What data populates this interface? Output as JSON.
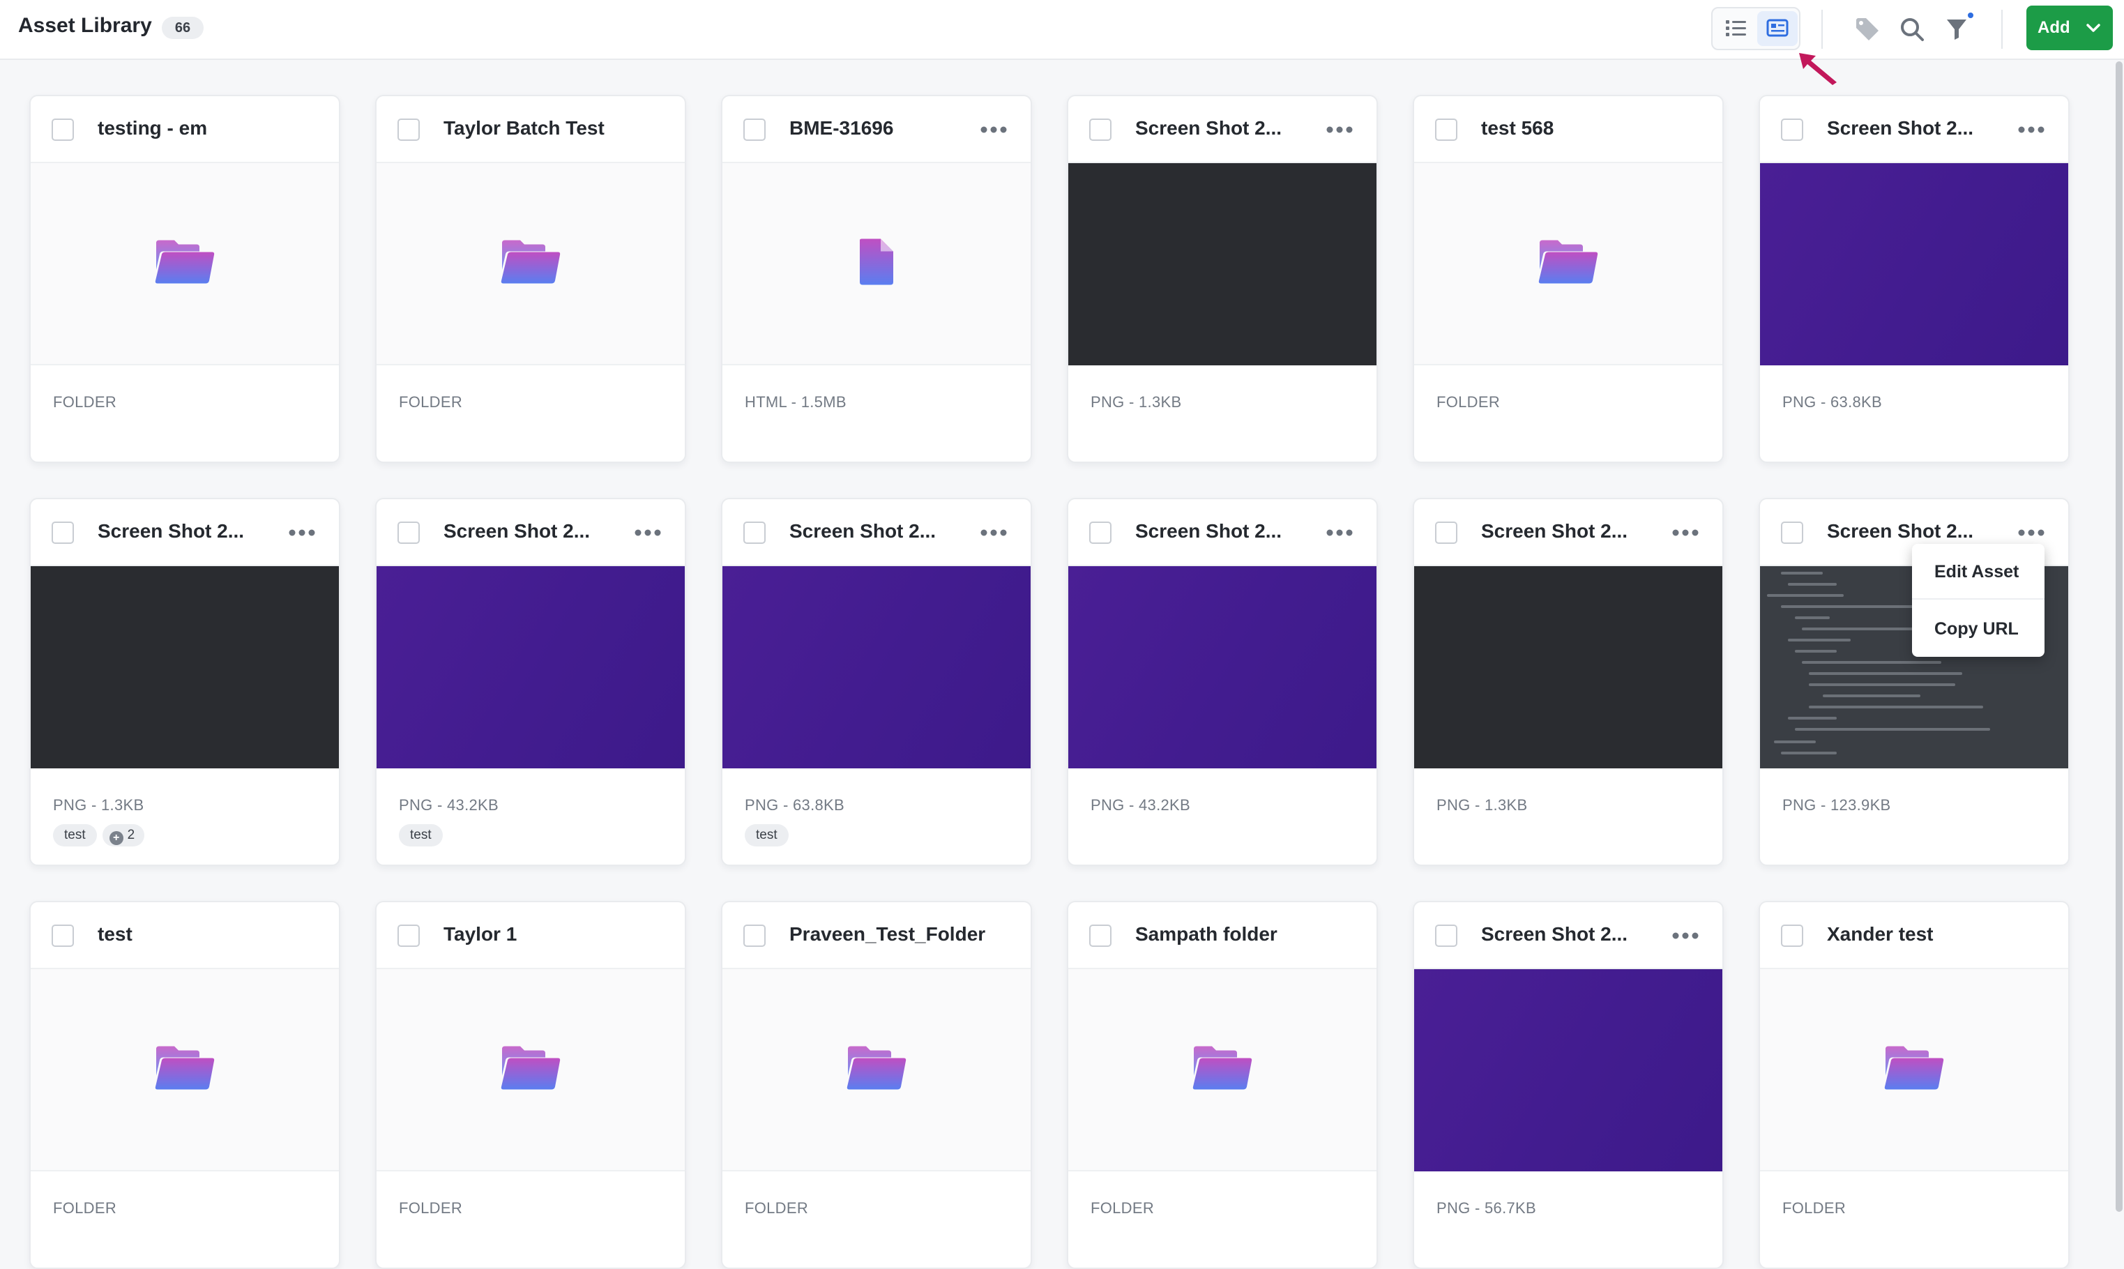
{
  "header": {
    "title": "Asset Library",
    "count": "66",
    "add_label": "Add",
    "icons": [
      "list-view-icon",
      "grid-view-icon",
      "tag-icon",
      "search-icon",
      "filter-icon",
      "chevron-down-icon"
    ]
  },
  "colors": {
    "accent_green": "#1c9c47",
    "active_view": "#2e6de0",
    "thumb_purple": "#421c8f",
    "thumb_dark": "#2a2c30",
    "folder_gradient_top": "#c04fc2",
    "folder_gradient_bottom": "#5a7ef0",
    "cursor_pink": "#c2185b"
  },
  "assets": [
    {
      "title": "testing - em",
      "meta": "FOLDER",
      "thumb": "folder",
      "menu": false,
      "tags": []
    },
    {
      "title": "Taylor Batch Test",
      "meta": "FOLDER",
      "thumb": "folder",
      "menu": false,
      "tags": []
    },
    {
      "title": "BME-31696",
      "meta": "HTML - 1.5MB",
      "thumb": "file",
      "menu": true,
      "tags": []
    },
    {
      "title": "Screen Shot 2...",
      "meta": "PNG - 1.3KB",
      "thumb": "dark",
      "menu": true,
      "tags": []
    },
    {
      "title": "test 568",
      "meta": "FOLDER",
      "thumb": "folder",
      "menu": false,
      "tags": []
    },
    {
      "title": "Screen Shot 2...",
      "meta": "PNG - 63.8KB",
      "thumb": "purple",
      "menu": true,
      "tags": []
    },
    {
      "title": "Screen Shot 2...",
      "meta": "PNG - 1.3KB",
      "thumb": "dark",
      "menu": true,
      "tags": [
        "test"
      ],
      "extra_tags": "2"
    },
    {
      "title": "Screen Shot 2...",
      "meta": "PNG - 43.2KB",
      "thumb": "purple",
      "menu": true,
      "tags": [
        "test"
      ]
    },
    {
      "title": "Screen Shot 2...",
      "meta": "PNG - 63.8KB",
      "thumb": "purple",
      "menu": true,
      "tags": [
        "test"
      ]
    },
    {
      "title": "Screen Shot 2...",
      "meta": "PNG - 43.2KB",
      "thumb": "purple",
      "menu": true,
      "tags": []
    },
    {
      "title": "Screen Shot 2...",
      "meta": "PNG - 1.3KB",
      "thumb": "dark",
      "menu": true,
      "tags": []
    },
    {
      "title": "Screen Shot 2...",
      "meta": "PNG - 123.9KB",
      "thumb": "doc",
      "menu": true,
      "tags": []
    },
    {
      "title": "test",
      "meta": "FOLDER",
      "thumb": "folder",
      "menu": false,
      "tags": []
    },
    {
      "title": "Taylor 1",
      "meta": "FOLDER",
      "thumb": "folder",
      "menu": false,
      "tags": []
    },
    {
      "title": "Praveen_Test_Folder",
      "meta": "FOLDER",
      "thumb": "folder",
      "menu": false,
      "tags": []
    },
    {
      "title": "Sampath folder",
      "meta": "FOLDER",
      "thumb": "folder",
      "menu": false,
      "tags": []
    },
    {
      "title": "Screen Shot 2...",
      "meta": "PNG - 56.7KB",
      "thumb": "purple",
      "menu": true,
      "tags": []
    },
    {
      "title": "Xander test",
      "meta": "FOLDER",
      "thumb": "folder",
      "menu": false,
      "tags": []
    }
  ],
  "context_menu": {
    "items": [
      "Edit Asset",
      "Copy URL"
    ]
  }
}
